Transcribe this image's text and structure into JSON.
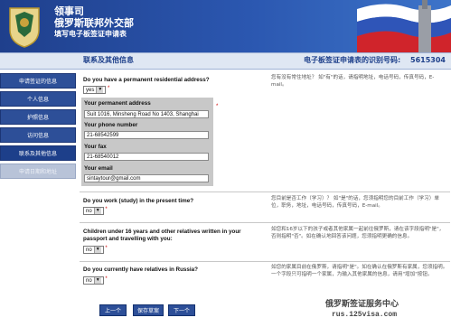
{
  "header": {
    "line1": "领事司",
    "line2": "俄罗斯联邦外交部",
    "line3": "填写电子板签证申请表"
  },
  "subbar": {
    "title": "联系及其他信息",
    "id_label": "电子板签证申请表的识别号码:",
    "id_value": "5615304"
  },
  "sidebar": {
    "items": [
      {
        "label": "申请签证的信息"
      },
      {
        "label": "个人信息"
      },
      {
        "label": "护照信息"
      },
      {
        "label": "访问信息"
      },
      {
        "label": "联系及其他信息"
      },
      {
        "label": "申请日期和地址"
      }
    ]
  },
  "q1": {
    "question": "Do you have a permanent residential address?",
    "value": "yes",
    "help": "您有没有常住地址？  如\"有\"的话，请指明地址，电话号码，传真号码，E-mail。"
  },
  "panel": {
    "address_label": "Your permanent address",
    "address_value": "Suit 1016, Minsheng Road No 1403, Shanghai",
    "phone_label": "Your phone number",
    "phone_value": "21-68542599",
    "fax_label": "Your fax",
    "fax_value": "21-68540012",
    "email_label": "Your email",
    "email_value": "sintaytour@gmail.com"
  },
  "q2": {
    "question": "Do you work (study) in the present time?",
    "value": "no",
    "help": "您目前是否工作（学习）？  如\"是\"的话，您须指明您的目前工作（学习）单位，职务，地址，电话号码，传真号码，E-mail。"
  },
  "q3": {
    "question": "Children under 16 years and other relatives written in your passport and travelling with you:",
    "value": "no",
    "help": "如您和16岁以下的孩子或者其他家属一起前往俄罗斯，请在该字段指明\"是\"，否则指明\"否\"。如在确认地回答该问题，您须指明更确的信息。"
  },
  "q4": {
    "question": "Do you currently have relatives in Russia?",
    "value": "no",
    "help": "如您的家属目前在俄罗斯，请指明\"是\"。如在确认在俄罗斯有家属，您须指明。一个字段只可指明一个家属，为输入其他家属的信息，请用\"增加\"按钮。"
  },
  "buttons": {
    "prev": "上一个",
    "save": "保存草案",
    "next": "下一个"
  },
  "watermark": {
    "line1": "俄罗斯签证服务中心",
    "line2": "rus.125visa.com"
  }
}
